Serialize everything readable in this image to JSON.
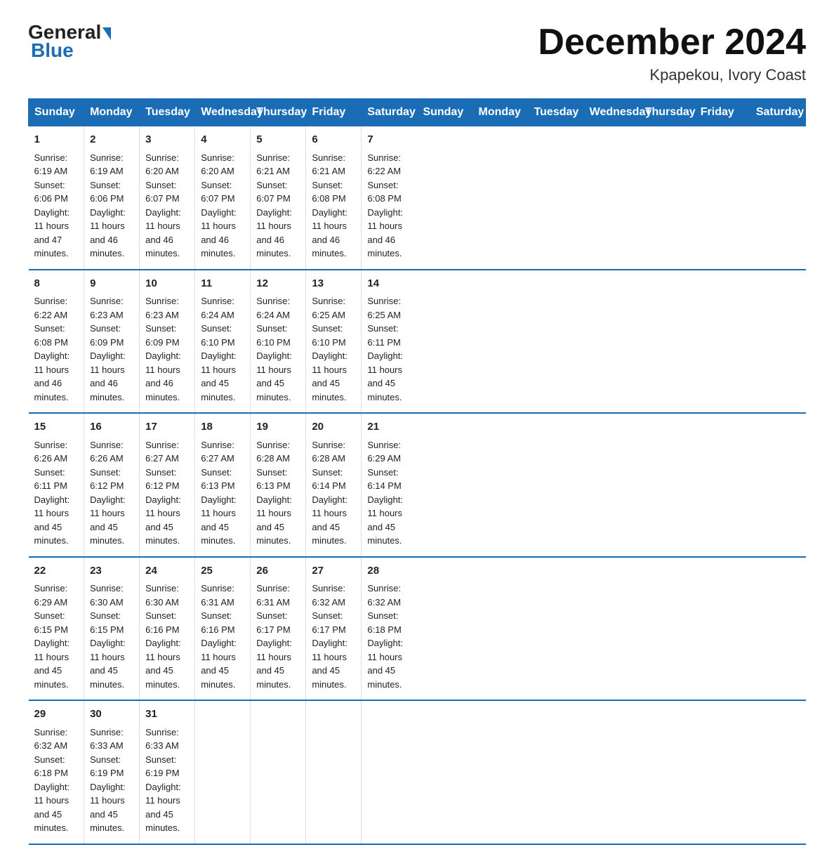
{
  "header": {
    "logo_general": "General",
    "logo_blue": "Blue",
    "month_title": "December 2024",
    "location": "Kpapekou, Ivory Coast"
  },
  "weekdays": [
    "Sunday",
    "Monday",
    "Tuesday",
    "Wednesday",
    "Thursday",
    "Friday",
    "Saturday"
  ],
  "weeks": [
    [
      {
        "day": "1",
        "info": "Sunrise: 6:19 AM\nSunset: 6:06 PM\nDaylight: 11 hours\nand 47 minutes."
      },
      {
        "day": "2",
        "info": "Sunrise: 6:19 AM\nSunset: 6:06 PM\nDaylight: 11 hours\nand 46 minutes."
      },
      {
        "day": "3",
        "info": "Sunrise: 6:20 AM\nSunset: 6:07 PM\nDaylight: 11 hours\nand 46 minutes."
      },
      {
        "day": "4",
        "info": "Sunrise: 6:20 AM\nSunset: 6:07 PM\nDaylight: 11 hours\nand 46 minutes."
      },
      {
        "day": "5",
        "info": "Sunrise: 6:21 AM\nSunset: 6:07 PM\nDaylight: 11 hours\nand 46 minutes."
      },
      {
        "day": "6",
        "info": "Sunrise: 6:21 AM\nSunset: 6:08 PM\nDaylight: 11 hours\nand 46 minutes."
      },
      {
        "day": "7",
        "info": "Sunrise: 6:22 AM\nSunset: 6:08 PM\nDaylight: 11 hours\nand 46 minutes."
      }
    ],
    [
      {
        "day": "8",
        "info": "Sunrise: 6:22 AM\nSunset: 6:08 PM\nDaylight: 11 hours\nand 46 minutes."
      },
      {
        "day": "9",
        "info": "Sunrise: 6:23 AM\nSunset: 6:09 PM\nDaylight: 11 hours\nand 46 minutes."
      },
      {
        "day": "10",
        "info": "Sunrise: 6:23 AM\nSunset: 6:09 PM\nDaylight: 11 hours\nand 46 minutes."
      },
      {
        "day": "11",
        "info": "Sunrise: 6:24 AM\nSunset: 6:10 PM\nDaylight: 11 hours\nand 45 minutes."
      },
      {
        "day": "12",
        "info": "Sunrise: 6:24 AM\nSunset: 6:10 PM\nDaylight: 11 hours\nand 45 minutes."
      },
      {
        "day": "13",
        "info": "Sunrise: 6:25 AM\nSunset: 6:10 PM\nDaylight: 11 hours\nand 45 minutes."
      },
      {
        "day": "14",
        "info": "Sunrise: 6:25 AM\nSunset: 6:11 PM\nDaylight: 11 hours\nand 45 minutes."
      }
    ],
    [
      {
        "day": "15",
        "info": "Sunrise: 6:26 AM\nSunset: 6:11 PM\nDaylight: 11 hours\nand 45 minutes."
      },
      {
        "day": "16",
        "info": "Sunrise: 6:26 AM\nSunset: 6:12 PM\nDaylight: 11 hours\nand 45 minutes."
      },
      {
        "day": "17",
        "info": "Sunrise: 6:27 AM\nSunset: 6:12 PM\nDaylight: 11 hours\nand 45 minutes."
      },
      {
        "day": "18",
        "info": "Sunrise: 6:27 AM\nSunset: 6:13 PM\nDaylight: 11 hours\nand 45 minutes."
      },
      {
        "day": "19",
        "info": "Sunrise: 6:28 AM\nSunset: 6:13 PM\nDaylight: 11 hours\nand 45 minutes."
      },
      {
        "day": "20",
        "info": "Sunrise: 6:28 AM\nSunset: 6:14 PM\nDaylight: 11 hours\nand 45 minutes."
      },
      {
        "day": "21",
        "info": "Sunrise: 6:29 AM\nSunset: 6:14 PM\nDaylight: 11 hours\nand 45 minutes."
      }
    ],
    [
      {
        "day": "22",
        "info": "Sunrise: 6:29 AM\nSunset: 6:15 PM\nDaylight: 11 hours\nand 45 minutes."
      },
      {
        "day": "23",
        "info": "Sunrise: 6:30 AM\nSunset: 6:15 PM\nDaylight: 11 hours\nand 45 minutes."
      },
      {
        "day": "24",
        "info": "Sunrise: 6:30 AM\nSunset: 6:16 PM\nDaylight: 11 hours\nand 45 minutes."
      },
      {
        "day": "25",
        "info": "Sunrise: 6:31 AM\nSunset: 6:16 PM\nDaylight: 11 hours\nand 45 minutes."
      },
      {
        "day": "26",
        "info": "Sunrise: 6:31 AM\nSunset: 6:17 PM\nDaylight: 11 hours\nand 45 minutes."
      },
      {
        "day": "27",
        "info": "Sunrise: 6:32 AM\nSunset: 6:17 PM\nDaylight: 11 hours\nand 45 minutes."
      },
      {
        "day": "28",
        "info": "Sunrise: 6:32 AM\nSunset: 6:18 PM\nDaylight: 11 hours\nand 45 minutes."
      }
    ],
    [
      {
        "day": "29",
        "info": "Sunrise: 6:32 AM\nSunset: 6:18 PM\nDaylight: 11 hours\nand 45 minutes."
      },
      {
        "day": "30",
        "info": "Sunrise: 6:33 AM\nSunset: 6:19 PM\nDaylight: 11 hours\nand 45 minutes."
      },
      {
        "day": "31",
        "info": "Sunrise: 6:33 AM\nSunset: 6:19 PM\nDaylight: 11 hours\nand 45 minutes."
      },
      {
        "day": "",
        "info": ""
      },
      {
        "day": "",
        "info": ""
      },
      {
        "day": "",
        "info": ""
      },
      {
        "day": "",
        "info": ""
      }
    ]
  ]
}
